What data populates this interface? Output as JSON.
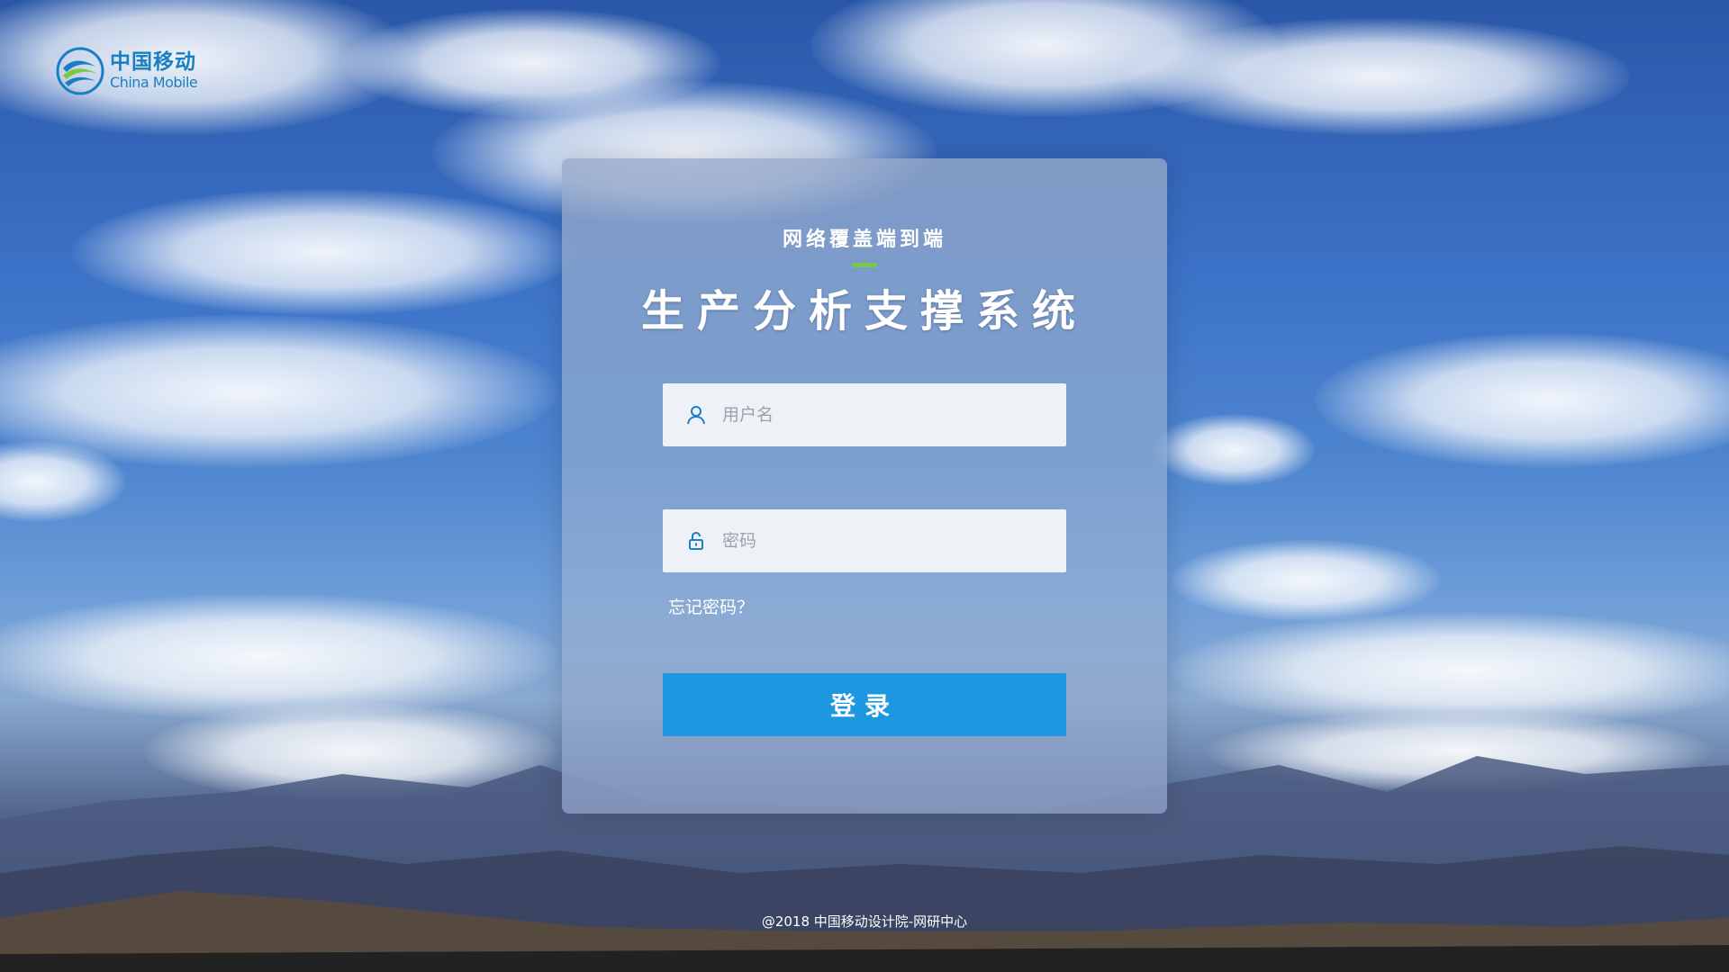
{
  "logo": {
    "name_cn": "中国移动",
    "name_en": "China Mobile",
    "icon": "china-mobile-logo",
    "color": "#1a7fc2"
  },
  "login": {
    "subtitle": "网络覆盖端到端",
    "title": "生产分析支撑系统",
    "username_placeholder": "用户名",
    "username_value": "",
    "password_placeholder": "密码",
    "password_value": "",
    "forgot_label": "忘记密码？",
    "submit_label": "登录",
    "username_icon": "user-icon",
    "password_icon": "lock-icon",
    "accent_color": "#7ac943",
    "button_color": "#1d97e0"
  },
  "footer": {
    "copyright": "@2018 中国移动设计院-网研中心"
  }
}
